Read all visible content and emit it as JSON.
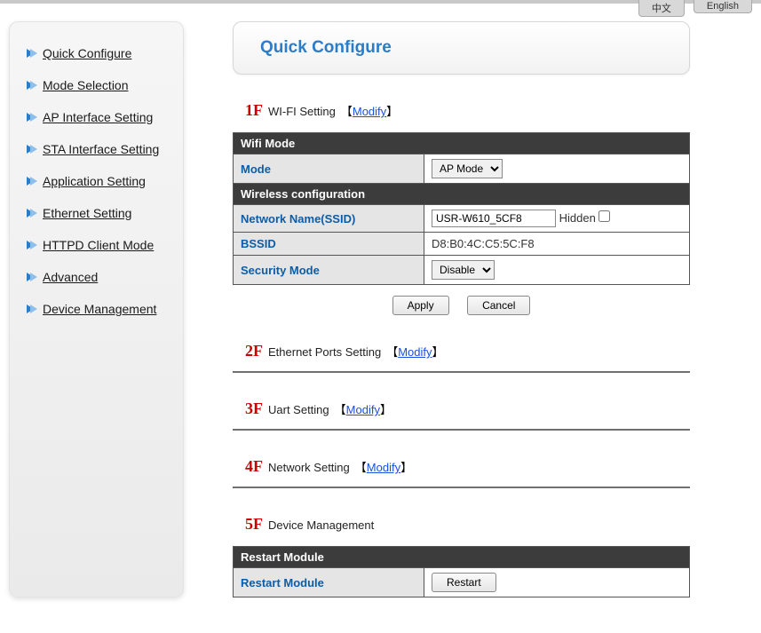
{
  "lang": {
    "zh": "中文",
    "en": "English"
  },
  "sidebar": {
    "items": [
      {
        "label": "Quick Configure"
      },
      {
        "label": "Mode Selection"
      },
      {
        "label": "AP Interface Setting"
      },
      {
        "label": "STA Interface Setting"
      },
      {
        "label": "Application Setting"
      },
      {
        "label": "Ethernet Setting"
      },
      {
        "label": "HTTPD Client Mode"
      },
      {
        "label": "Advanced"
      },
      {
        "label": "Device Management"
      }
    ]
  },
  "header": {
    "title": "Quick Configure"
  },
  "sections": {
    "s1": {
      "num": "1F",
      "label": "WI-FI Setting",
      "modify": "Modify"
    },
    "s2": {
      "num": "2F",
      "label": "Ethernet Ports Setting",
      "modify": "Modify"
    },
    "s3": {
      "num": "3F",
      "label": "Uart Setting",
      "modify": "Modify"
    },
    "s4": {
      "num": "4F",
      "label": "Network Setting",
      "modify": "Modify"
    },
    "s5": {
      "num": "5F",
      "label": "Device Management"
    }
  },
  "wifi": {
    "group1": "Wifi Mode",
    "mode_label": "Mode",
    "mode_value": "AP Mode",
    "group2": "Wireless configuration",
    "ssid_label": "Network Name(SSID)",
    "ssid_value": "USR-W610_5CF8",
    "hidden_label": "Hidden",
    "bssid_label": "BSSID",
    "bssid_value": "D8:B0:4C:C5:5C:F8",
    "sec_label": "Security Mode",
    "sec_value": "Disable",
    "apply": "Apply",
    "cancel": "Cancel"
  },
  "restart": {
    "group": "Restart Module",
    "label": "Restart Module",
    "button": "Restart"
  }
}
